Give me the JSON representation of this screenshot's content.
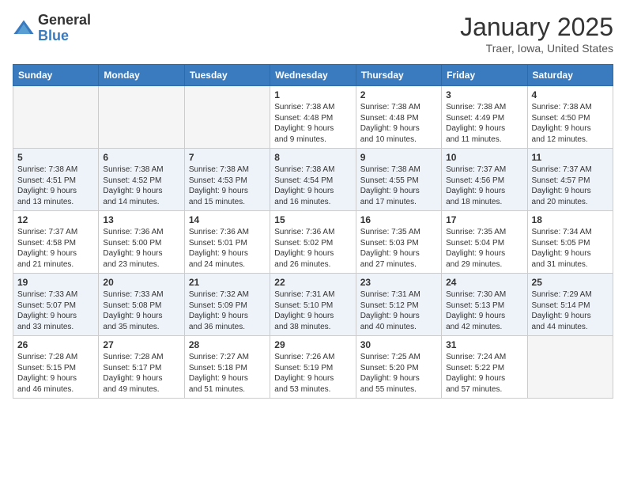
{
  "logo": {
    "general": "General",
    "blue": "Blue"
  },
  "header": {
    "month": "January 2025",
    "location": "Traer, Iowa, United States"
  },
  "weekdays": [
    "Sunday",
    "Monday",
    "Tuesday",
    "Wednesday",
    "Thursday",
    "Friday",
    "Saturday"
  ],
  "weeks": [
    [
      {
        "day": "",
        "text": ""
      },
      {
        "day": "",
        "text": ""
      },
      {
        "day": "",
        "text": ""
      },
      {
        "day": "1",
        "text": "Sunrise: 7:38 AM\nSunset: 4:48 PM\nDaylight: 9 hours\nand 9 minutes."
      },
      {
        "day": "2",
        "text": "Sunrise: 7:38 AM\nSunset: 4:48 PM\nDaylight: 9 hours\nand 10 minutes."
      },
      {
        "day": "3",
        "text": "Sunrise: 7:38 AM\nSunset: 4:49 PM\nDaylight: 9 hours\nand 11 minutes."
      },
      {
        "day": "4",
        "text": "Sunrise: 7:38 AM\nSunset: 4:50 PM\nDaylight: 9 hours\nand 12 minutes."
      }
    ],
    [
      {
        "day": "5",
        "text": "Sunrise: 7:38 AM\nSunset: 4:51 PM\nDaylight: 9 hours\nand 13 minutes."
      },
      {
        "day": "6",
        "text": "Sunrise: 7:38 AM\nSunset: 4:52 PM\nDaylight: 9 hours\nand 14 minutes."
      },
      {
        "day": "7",
        "text": "Sunrise: 7:38 AM\nSunset: 4:53 PM\nDaylight: 9 hours\nand 15 minutes."
      },
      {
        "day": "8",
        "text": "Sunrise: 7:38 AM\nSunset: 4:54 PM\nDaylight: 9 hours\nand 16 minutes."
      },
      {
        "day": "9",
        "text": "Sunrise: 7:38 AM\nSunset: 4:55 PM\nDaylight: 9 hours\nand 17 minutes."
      },
      {
        "day": "10",
        "text": "Sunrise: 7:37 AM\nSunset: 4:56 PM\nDaylight: 9 hours\nand 18 minutes."
      },
      {
        "day": "11",
        "text": "Sunrise: 7:37 AM\nSunset: 4:57 PM\nDaylight: 9 hours\nand 20 minutes."
      }
    ],
    [
      {
        "day": "12",
        "text": "Sunrise: 7:37 AM\nSunset: 4:58 PM\nDaylight: 9 hours\nand 21 minutes."
      },
      {
        "day": "13",
        "text": "Sunrise: 7:36 AM\nSunset: 5:00 PM\nDaylight: 9 hours\nand 23 minutes."
      },
      {
        "day": "14",
        "text": "Sunrise: 7:36 AM\nSunset: 5:01 PM\nDaylight: 9 hours\nand 24 minutes."
      },
      {
        "day": "15",
        "text": "Sunrise: 7:36 AM\nSunset: 5:02 PM\nDaylight: 9 hours\nand 26 minutes."
      },
      {
        "day": "16",
        "text": "Sunrise: 7:35 AM\nSunset: 5:03 PM\nDaylight: 9 hours\nand 27 minutes."
      },
      {
        "day": "17",
        "text": "Sunrise: 7:35 AM\nSunset: 5:04 PM\nDaylight: 9 hours\nand 29 minutes."
      },
      {
        "day": "18",
        "text": "Sunrise: 7:34 AM\nSunset: 5:05 PM\nDaylight: 9 hours\nand 31 minutes."
      }
    ],
    [
      {
        "day": "19",
        "text": "Sunrise: 7:33 AM\nSunset: 5:07 PM\nDaylight: 9 hours\nand 33 minutes."
      },
      {
        "day": "20",
        "text": "Sunrise: 7:33 AM\nSunset: 5:08 PM\nDaylight: 9 hours\nand 35 minutes."
      },
      {
        "day": "21",
        "text": "Sunrise: 7:32 AM\nSunset: 5:09 PM\nDaylight: 9 hours\nand 36 minutes."
      },
      {
        "day": "22",
        "text": "Sunrise: 7:31 AM\nSunset: 5:10 PM\nDaylight: 9 hours\nand 38 minutes."
      },
      {
        "day": "23",
        "text": "Sunrise: 7:31 AM\nSunset: 5:12 PM\nDaylight: 9 hours\nand 40 minutes."
      },
      {
        "day": "24",
        "text": "Sunrise: 7:30 AM\nSunset: 5:13 PM\nDaylight: 9 hours\nand 42 minutes."
      },
      {
        "day": "25",
        "text": "Sunrise: 7:29 AM\nSunset: 5:14 PM\nDaylight: 9 hours\nand 44 minutes."
      }
    ],
    [
      {
        "day": "26",
        "text": "Sunrise: 7:28 AM\nSunset: 5:15 PM\nDaylight: 9 hours\nand 46 minutes."
      },
      {
        "day": "27",
        "text": "Sunrise: 7:28 AM\nSunset: 5:17 PM\nDaylight: 9 hours\nand 49 minutes."
      },
      {
        "day": "28",
        "text": "Sunrise: 7:27 AM\nSunset: 5:18 PM\nDaylight: 9 hours\nand 51 minutes."
      },
      {
        "day": "29",
        "text": "Sunrise: 7:26 AM\nSunset: 5:19 PM\nDaylight: 9 hours\nand 53 minutes."
      },
      {
        "day": "30",
        "text": "Sunrise: 7:25 AM\nSunset: 5:20 PM\nDaylight: 9 hours\nand 55 minutes."
      },
      {
        "day": "31",
        "text": "Sunrise: 7:24 AM\nSunset: 5:22 PM\nDaylight: 9 hours\nand 57 minutes."
      },
      {
        "day": "",
        "text": ""
      }
    ]
  ]
}
